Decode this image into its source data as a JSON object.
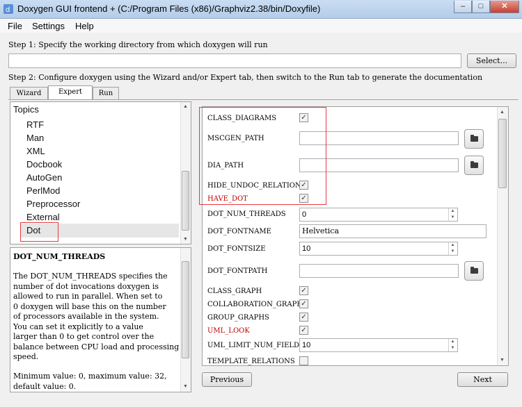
{
  "window": {
    "title": "Doxygen GUI frontend + (C:/Program Files (x86)/Graphviz2.38/bin/Doxyfile)",
    "minimize": "–",
    "maximize": "□",
    "close": "✕"
  },
  "menu": [
    "File",
    "Settings",
    "Help"
  ],
  "step1": {
    "label": "Step 1: Specify the working directory from which doxygen will run",
    "dir_value": "",
    "select_button": "Select..."
  },
  "step2": {
    "label": "Step 2: Configure doxygen using the Wizard and/or Expert tab, then switch to the Run tab to generate the documentation"
  },
  "tabs": [
    {
      "label": "Wizard",
      "active": false
    },
    {
      "label": "Expert",
      "active": true
    },
    {
      "label": "Run",
      "active": false
    }
  ],
  "topics": {
    "header": "Topics",
    "items": [
      "RTF",
      "Man",
      "XML",
      "Docbook",
      "AutoGen",
      "PerlMod",
      "Preprocessor",
      "External",
      "Dot"
    ],
    "selected": "Dot"
  },
  "help": {
    "title": "DOT_NUM_THREADS",
    "lines": [
      "The DOT_NUM_THREADS specifies the",
      "number of dot invocations doxygen is",
      "allowed to run in parallel. When set to",
      "0 doxygen will base this on the number",
      "of processors available in the system.",
      "You can set it explicitly to a value",
      "larger than 0 to get control over the",
      "balance between CPU load and processing",
      "speed."
    ],
    "footer_lines": [
      "Minimum value: 0, maximum value: 32,",
      "default value: 0."
    ]
  },
  "settings": {
    "class_diagrams": {
      "label": "CLASS_DIAGRAMS",
      "checked": true
    },
    "mscgen_path": {
      "label": "MSCGEN_PATH",
      "value": ""
    },
    "dia_path": {
      "label": "DIA_PATH",
      "value": ""
    },
    "hide_undoc_relations": {
      "label": "HIDE_UNDOC_RELATIONS",
      "checked": true
    },
    "have_dot": {
      "label": "HAVE_DOT",
      "checked": true,
      "modified": true
    },
    "dot_num_threads": {
      "label": "DOT_NUM_THREADS",
      "value": "0"
    },
    "dot_fontname": {
      "label": "DOT_FONTNAME",
      "value": "Helvetica"
    },
    "dot_fontsize": {
      "label": "DOT_FONTSIZE",
      "value": "10"
    },
    "dot_fontpath": {
      "label": "DOT_FONTPATH",
      "value": ""
    },
    "class_graph": {
      "label": "CLASS_GRAPH",
      "checked": true
    },
    "collaboration_graph": {
      "label": "COLLABORATION_GRAPH",
      "checked": true
    },
    "group_graphs": {
      "label": "GROUP_GRAPHS",
      "checked": true
    },
    "uml_look": {
      "label": "UML_LOOK",
      "checked": true,
      "modified": true
    },
    "uml_limit_num_fields": {
      "label": "UML_LIMIT_NUM_FIELDS",
      "value": "10"
    },
    "template_relations": {
      "label": "TEMPLATE_RELATIONS",
      "checked": false
    }
  },
  "nav": {
    "previous": "Previous",
    "next": "Next"
  },
  "check_glyph": "✓",
  "colors": {
    "modified_label": "#c00000",
    "highlight_box": "#e8383d"
  }
}
